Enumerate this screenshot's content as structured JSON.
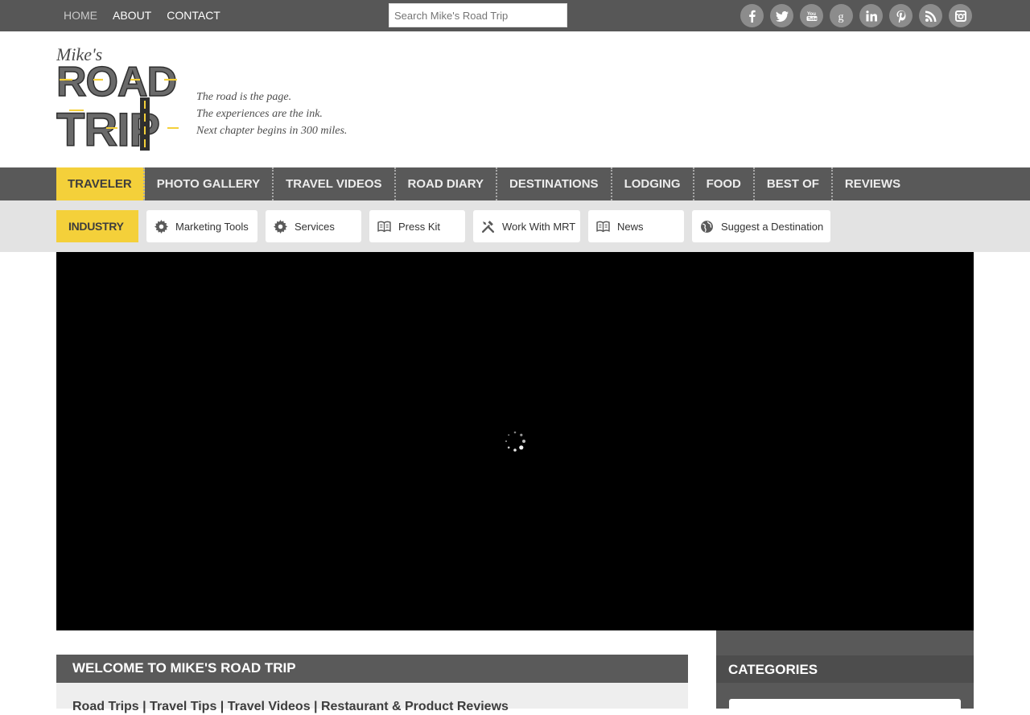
{
  "topnav": {
    "items": [
      "HOME",
      "ABOUT",
      "CONTACT"
    ],
    "active": "HOME"
  },
  "search": {
    "placeholder": "Search Mike's Road Trip"
  },
  "social": [
    "facebook-icon",
    "twitter-icon",
    "youtube-icon",
    "google-icon",
    "linkedin-icon",
    "pinterest-icon",
    "rss-icon",
    "instagram-icon"
  ],
  "logo": {
    "script": "Mike's",
    "line1": "ROAD",
    "line2": "TRIP"
  },
  "tagline": {
    "line1": "The road is the page.",
    "line2": "The experiences are the ink.",
    "line3": "Next chapter begins in 300 miles."
  },
  "mainnav": {
    "items": [
      "TRAVELER",
      "PHOTO GALLERY",
      "TRAVEL VIDEOS",
      "ROAD DIARY",
      "DESTINATIONS",
      "LODGING",
      "FOOD",
      "BEST OF",
      "REVIEWS"
    ]
  },
  "subnav": {
    "label": "INDUSTRY",
    "items": [
      "Marketing Tools",
      "Services",
      "Press Kit",
      "Work With MRT",
      "News",
      "Suggest a Destination"
    ]
  },
  "welcome": {
    "title": "WELCOME TO MIKE'S ROAD TRIP",
    "links": "Road Trips | Travel Tips | Travel Videos | Restaurant & Product Reviews"
  },
  "sidebar": {
    "categories_title": "CATEGORIES"
  },
  "colors": {
    "accent": "#f4d03a",
    "dark": "#595959",
    "text": "#3d3d3d"
  }
}
